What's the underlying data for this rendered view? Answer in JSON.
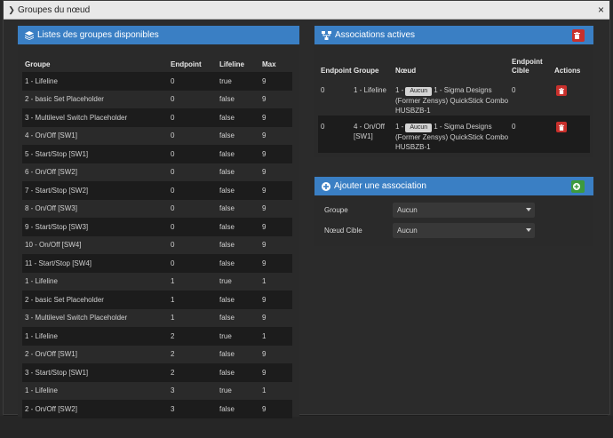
{
  "modal": {
    "title": "Groupes du nœud",
    "close": "×"
  },
  "groups_panel": {
    "title": "Listes des groupes disponibles",
    "headers": {
      "group": "Groupe",
      "endpoint": "Endpoint",
      "lifeline": "Lifeline",
      "max": "Max"
    },
    "rows": [
      {
        "group": "1 - Lifeline",
        "endpoint": "0",
        "lifeline": "true",
        "max": "9"
      },
      {
        "group": "2 - basic Set Placeholder",
        "endpoint": "0",
        "lifeline": "false",
        "max": "9"
      },
      {
        "group": "3 - Multilevel Switch Placeholder",
        "endpoint": "0",
        "lifeline": "false",
        "max": "9"
      },
      {
        "group": "4 - On/Off [SW1]",
        "endpoint": "0",
        "lifeline": "false",
        "max": "9"
      },
      {
        "group": "5 - Start/Stop [SW1]",
        "endpoint": "0",
        "lifeline": "false",
        "max": "9"
      },
      {
        "group": "6 - On/Off [SW2]",
        "endpoint": "0",
        "lifeline": "false",
        "max": "9"
      },
      {
        "group": "7 - Start/Stop [SW2]",
        "endpoint": "0",
        "lifeline": "false",
        "max": "9"
      },
      {
        "group": "8 - On/Off [SW3]",
        "endpoint": "0",
        "lifeline": "false",
        "max": "9"
      },
      {
        "group": "9 - Start/Stop [SW3]",
        "endpoint": "0",
        "lifeline": "false",
        "max": "9"
      },
      {
        "group": "10 - On/Off [SW4]",
        "endpoint": "0",
        "lifeline": "false",
        "max": "9"
      },
      {
        "group": "11 - Start/Stop [SW4]",
        "endpoint": "0",
        "lifeline": "false",
        "max": "9"
      },
      {
        "group": "1 - Lifeline",
        "endpoint": "1",
        "lifeline": "true",
        "max": "1"
      },
      {
        "group": "2 - basic Set Placeholder",
        "endpoint": "1",
        "lifeline": "false",
        "max": "9"
      },
      {
        "group": "3 - Multilevel Switch Placeholder",
        "endpoint": "1",
        "lifeline": "false",
        "max": "9"
      },
      {
        "group": "1 - Lifeline",
        "endpoint": "2",
        "lifeline": "true",
        "max": "1"
      },
      {
        "group": "2 - On/Off [SW1]",
        "endpoint": "2",
        "lifeline": "false",
        "max": "9"
      },
      {
        "group": "3 - Start/Stop [SW1]",
        "endpoint": "2",
        "lifeline": "false",
        "max": "9"
      },
      {
        "group": "1 - Lifeline",
        "endpoint": "3",
        "lifeline": "true",
        "max": "1"
      },
      {
        "group": "2 - On/Off [SW2]",
        "endpoint": "3",
        "lifeline": "false",
        "max": "9"
      }
    ]
  },
  "assoc_panel": {
    "title": "Associations actives",
    "headers": {
      "endpoint": "Endpoint",
      "group": "Groupe",
      "node": "Nœud",
      "target_line1": "Endpoint",
      "target_line2": "Cible",
      "actions": "Actions"
    },
    "rows": [
      {
        "endpoint": "0",
        "group": "1 - Lifeline",
        "node_prefix": "1 -",
        "node_button": "Aucun",
        "node_text": "1 - Sigma Designs (Former Zensys) QuickStick Combo HUSBZB-1",
        "target": "0"
      },
      {
        "endpoint": "0",
        "group": "4 - On/Off [SW1]",
        "node_prefix": "1 -",
        "node_button": "Aucun",
        "node_text": "1 - Sigma Designs (Former Zensys) QuickStick Combo HUSBZB-1",
        "target": "0"
      }
    ]
  },
  "add_panel": {
    "title": "Ajouter une association",
    "group_label": "Groupe",
    "group_value": "Aucun",
    "target_label": "Nœud Cible",
    "target_value": "Aucun"
  },
  "colors": {
    "header_blue": "#3a7fc4",
    "danger_red": "#c9302c",
    "success_green": "#3d9a3d"
  },
  "icons": {
    "groups": "layers-icon",
    "assoc": "sitemap-icon",
    "add": "plus-circle-icon",
    "delete": "trash-icon",
    "expand": "chevron-right-icon"
  }
}
